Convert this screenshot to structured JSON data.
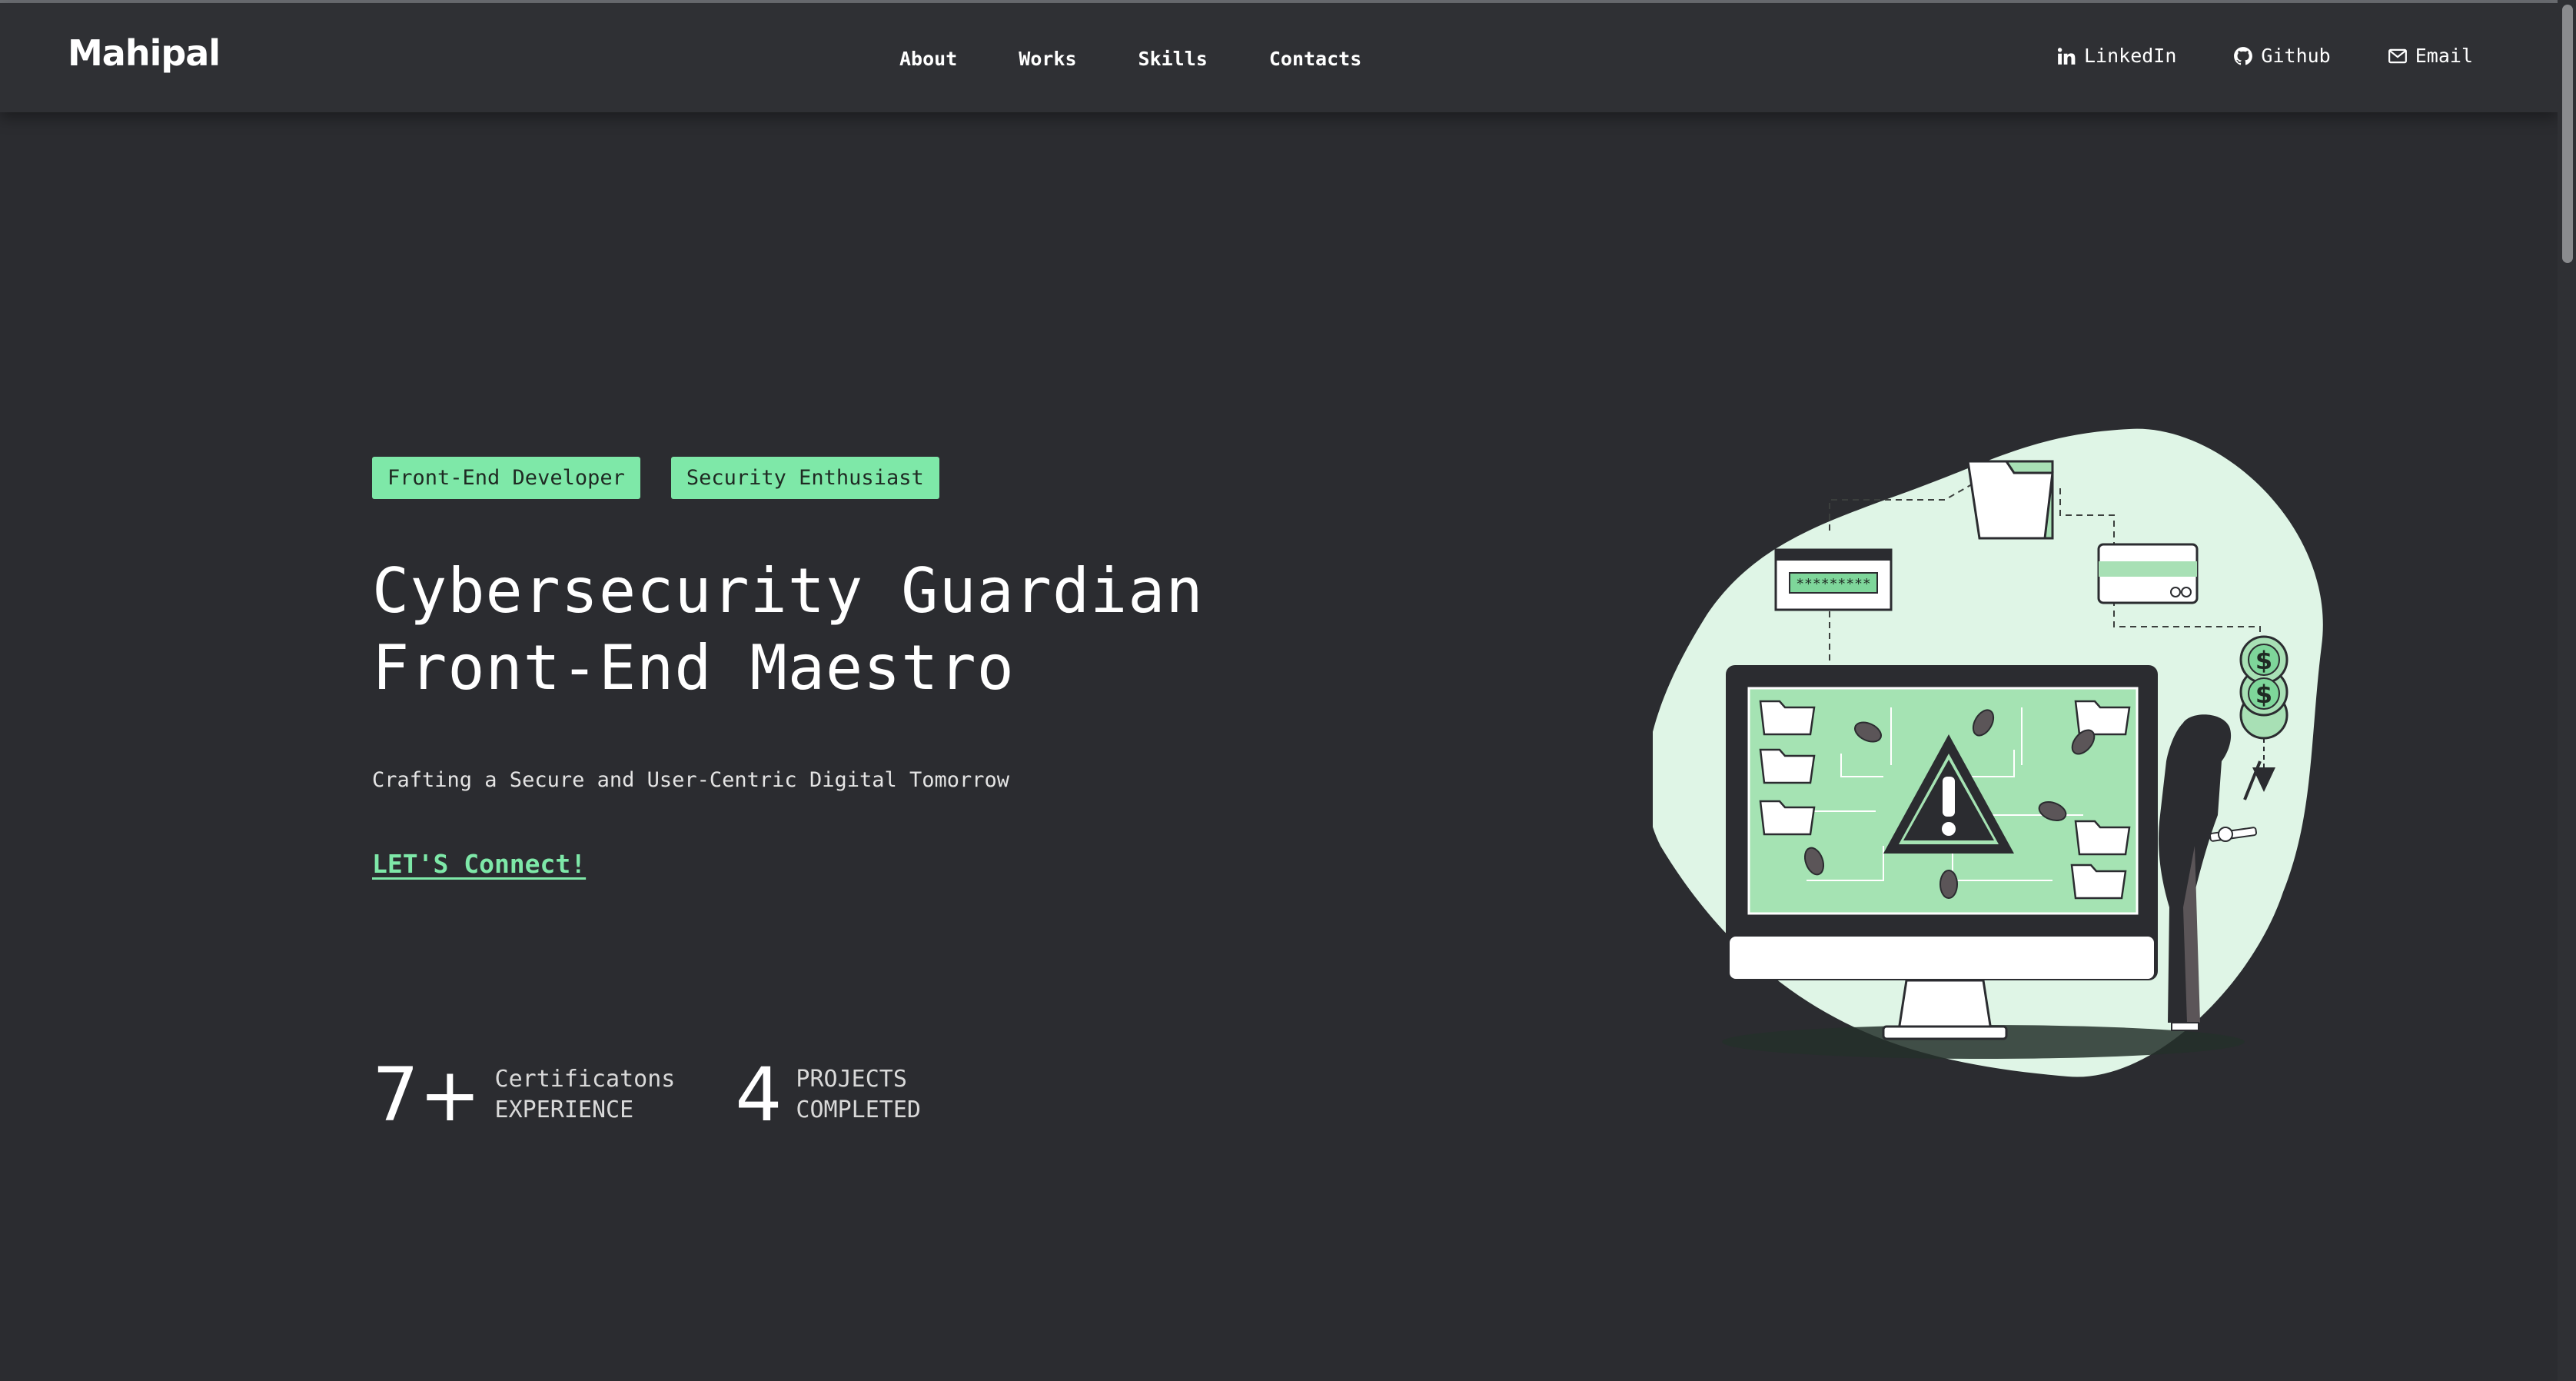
{
  "nav": {
    "logo": "Mahipal",
    "links": [
      "About",
      "Works",
      "Skills",
      "Contacts"
    ],
    "social": [
      {
        "label": "LinkedIn",
        "icon": "linkedin-icon"
      },
      {
        "label": "Github",
        "icon": "github-icon"
      },
      {
        "label": "Email",
        "icon": "mail-icon"
      }
    ]
  },
  "hero": {
    "tags": [
      "Front-End Developer",
      "Security Enthusiast"
    ],
    "headline": [
      "Cybersecurity Guardian",
      "Front-End Maestro"
    ],
    "subtitle": "Crafting a Secure and User-Centric Digital Tomorrow",
    "cta": "LET'S Connect!"
  },
  "stats": [
    {
      "value": "7+",
      "line1": "Certificatons",
      "line2": "EXPERIENCE"
    },
    {
      "value": "4",
      "line1": "PROJECTS",
      "line2": "COMPLETED"
    }
  ],
  "illustration": {
    "password_mask": "*********",
    "coin_symbol": "$"
  },
  "colors": {
    "background": "#2b2c30",
    "navbar": "#2f3034",
    "accent": "#7ee8a8",
    "blob": "#dff5e6"
  }
}
